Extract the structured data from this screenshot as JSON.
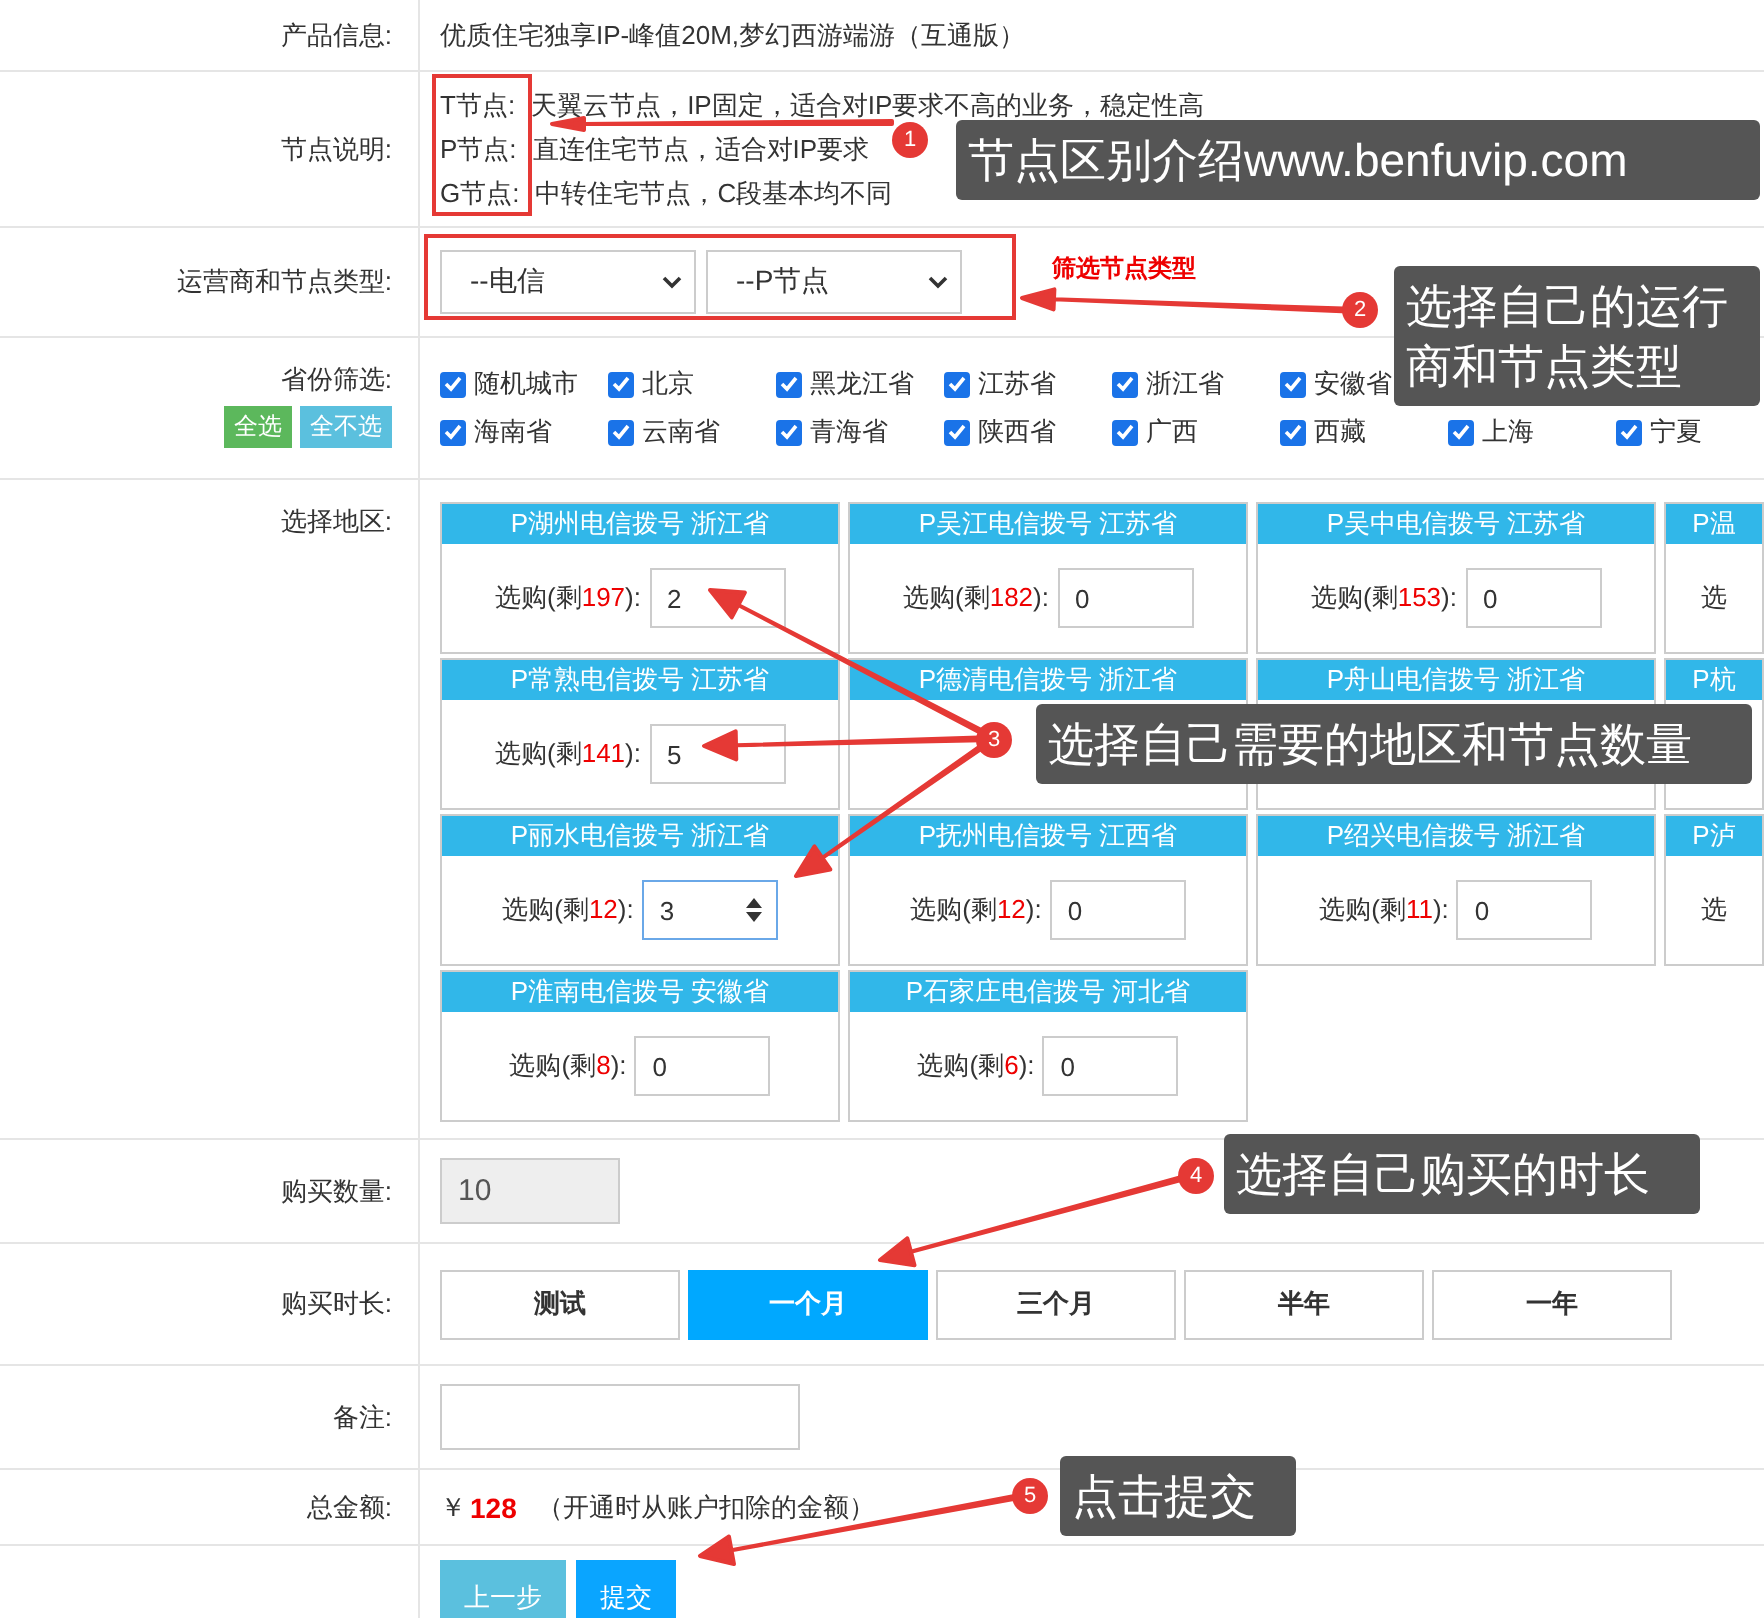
{
  "product": {
    "label": "产品信息:",
    "value": "优质住宅独享IP-峰值20M,梦幻西游端游（互通版）"
  },
  "nodes": {
    "label": "节点说明:",
    "items": [
      {
        "name": "T节点:",
        "desc": "天翼云节点，IP固定，适合对IP要求不高的业务，稳定性高"
      },
      {
        "name": "P节点:",
        "desc": "直连住宅节点，适合对IP要求"
      },
      {
        "name": "G节点:",
        "desc": "中转住宅节点，C段基本均不同"
      }
    ]
  },
  "carrier": {
    "label": "运营商和节点类型:",
    "selects": [
      "--电信",
      "--P节点"
    ],
    "hint": "筛选节点类型"
  },
  "provinces": {
    "label": "省份筛选:",
    "select_all": "全选",
    "select_none": "全不选",
    "rows": [
      [
        {
          "name": "随机城市",
          "checked": true
        },
        {
          "name": "北京",
          "checked": true
        },
        {
          "name": "黑龙江省",
          "checked": true
        },
        {
          "name": "江苏省",
          "checked": true
        },
        {
          "name": "浙江省",
          "checked": true
        },
        {
          "name": "安徽省",
          "checked": true
        }
      ],
      [
        {
          "name": "海南省",
          "checked": true
        },
        {
          "name": "云南省",
          "checked": true
        },
        {
          "name": "青海省",
          "checked": true
        },
        {
          "name": "陕西省",
          "checked": true
        },
        {
          "name": "广西",
          "checked": true
        },
        {
          "name": "西藏",
          "checked": true
        },
        {
          "name": "上海",
          "checked": true
        },
        {
          "name": "宁夏",
          "checked": true
        }
      ]
    ]
  },
  "regions": {
    "label": "选择地区:",
    "rows": [
      [
        {
          "kind": "full",
          "title": "P湖州电信拨号 浙江省",
          "prefix": "选购(剩",
          "remaining": "197",
          "suffix": "):",
          "value": "2",
          "focused": false
        },
        {
          "kind": "full",
          "title": "P吴江电信拨号 江苏省",
          "prefix": "选购(剩",
          "remaining": "182",
          "suffix": "):",
          "value": "0",
          "focused": false
        },
        {
          "kind": "full",
          "title": "P吴中电信拨号 江苏省",
          "prefix": "选购(剩",
          "remaining": "153",
          "suffix": "):",
          "value": "0",
          "focused": false
        },
        {
          "kind": "cut",
          "title": "P温",
          "prefix": "选"
        }
      ],
      [
        {
          "kind": "full",
          "title": "P常熟电信拨号 江苏省",
          "prefix": "选购(剩",
          "remaining": "141",
          "suffix": "):",
          "value": "5",
          "focused": false
        },
        {
          "kind": "covered",
          "title": "P德清电信拨号 浙江省"
        },
        {
          "kind": "covered",
          "title": "P舟山电信拨号 浙江省"
        },
        {
          "kind": "cut",
          "title": "P杭"
        }
      ],
      [
        {
          "kind": "full",
          "title": "P丽水电信拨号 浙江省",
          "prefix": "选购(剩",
          "remaining": "12",
          "suffix": "):",
          "value": "3",
          "focused": true
        },
        {
          "kind": "full",
          "title": "P抚州电信拨号 江西省",
          "prefix": "选购(剩",
          "remaining": "12",
          "suffix": "):",
          "value": "0",
          "focused": false
        },
        {
          "kind": "full",
          "title": "P绍兴电信拨号 浙江省",
          "prefix": "选购(剩",
          "remaining": "11",
          "suffix": "):",
          "value": "0",
          "focused": false
        },
        {
          "kind": "cut",
          "title": "P泸",
          "prefix": "选"
        }
      ],
      [
        {
          "kind": "full",
          "title": "P淮南电信拨号 安徽省",
          "prefix": "选购(剩",
          "remaining": "8",
          "suffix": "):",
          "value": "0",
          "focused": false
        },
        {
          "kind": "full",
          "title": "P石家庄电信拨号 河北省",
          "prefix": "选购(剩",
          "remaining": "6",
          "suffix": "):",
          "value": "0",
          "focused": false
        }
      ]
    ]
  },
  "quantity": {
    "label": "购买数量:",
    "value": "10"
  },
  "duration": {
    "label": "购买时长:",
    "options": [
      {
        "label": "测试",
        "selected": false
      },
      {
        "label": "一个月",
        "selected": true
      },
      {
        "label": "三个月",
        "selected": false
      },
      {
        "label": "半年",
        "selected": false
      },
      {
        "label": "一年",
        "selected": false
      }
    ]
  },
  "note": {
    "label": "备注:"
  },
  "total": {
    "label": "总金额:",
    "currency": "￥",
    "amount": "128",
    "hint": "（开通时从账户扣除的金额）"
  },
  "actions": {
    "back": "上一步",
    "submit": "提交"
  },
  "callouts": [
    {
      "number": "1",
      "text": "节点区别介绍www.benfuvip.com"
    },
    {
      "number": "2",
      "text": "选择自己的运行商和节点类型"
    },
    {
      "number": "3",
      "text": "选择自己需要的地区和节点数量"
    },
    {
      "number": "4",
      "text": "选择自己购买的时长"
    },
    {
      "number": "5",
      "text": "点击提交"
    }
  ]
}
